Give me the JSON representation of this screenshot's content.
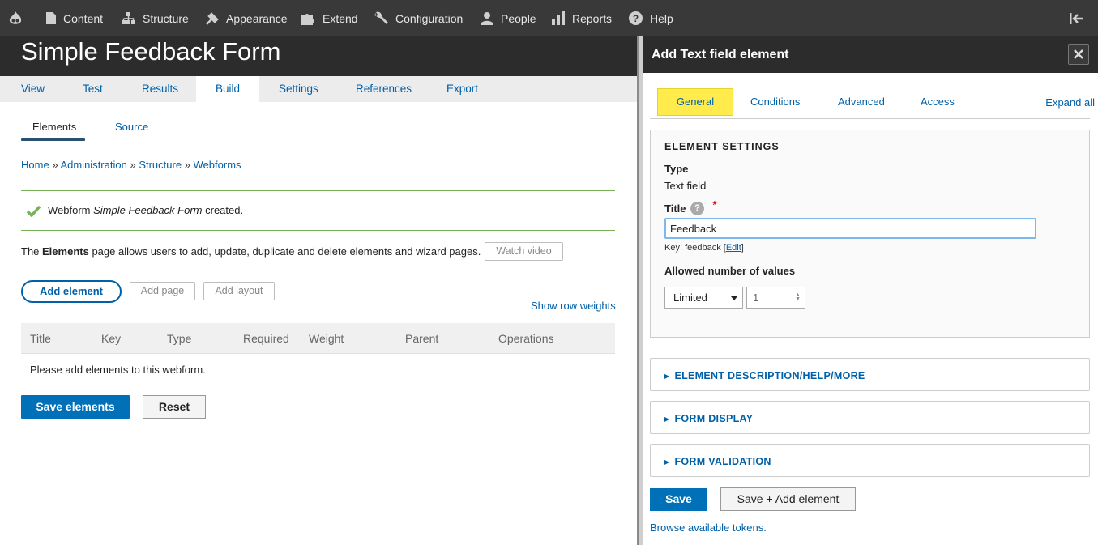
{
  "toolbar": {
    "items": [
      "Content",
      "Structure",
      "Appearance",
      "Extend",
      "Configuration",
      "People",
      "Reports",
      "Help"
    ]
  },
  "header": {
    "title": "Simple Feedback Form"
  },
  "primary_tabs": [
    "View",
    "Test",
    "Results",
    "Build",
    "Settings",
    "References",
    "Export"
  ],
  "active_primary_tab": "Build",
  "secondary_tabs": [
    "Elements",
    "Source"
  ],
  "breadcrumb": [
    "Home",
    "Administration",
    "Structure",
    "Webforms"
  ],
  "breadcrumb_separator": "»",
  "message": {
    "prefix": "Webform ",
    "name": "Simple Feedback Form",
    "suffix": " created."
  },
  "intro": {
    "prefix": "The ",
    "bold": "Elements",
    "suffix": " page allows users to add, update, duplicate and delete elements and wizard pages."
  },
  "buttons": {
    "watch_video": "Watch video",
    "add_element": "Add element",
    "add_page": "Add page",
    "add_layout": "Add layout",
    "show_row_weights": "Show row weights",
    "save_elements": "Save elements",
    "reset": "Reset"
  },
  "table": {
    "columns": [
      "Title",
      "Key",
      "Type",
      "Required",
      "Weight",
      "Parent",
      "Operations"
    ],
    "empty_text": "Please add elements to this webform."
  },
  "dialog": {
    "title": "Add Text field element",
    "tabs": [
      "General",
      "Conditions",
      "Advanced",
      "Access"
    ],
    "expand_all": "Expand all",
    "fieldset_legend": "ELEMENT SETTINGS",
    "type_label": "Type",
    "type_value": "Text field",
    "title_label": "Title",
    "title_help": "?",
    "required_mark": "*",
    "title_value": "Feedback",
    "key_prefix": "Key: feedback [",
    "key_edit": "Edit",
    "key_suffix": "]",
    "allowed_values_label": "Allowed number of values",
    "allowed_select": "Limited",
    "allowed_number": "1",
    "sections": [
      "ELEMENT DESCRIPTION/HELP/MORE",
      "FORM DISPLAY",
      "FORM VALIDATION"
    ],
    "save": "Save",
    "save_add": "Save + Add element",
    "tokens_link": "Browse available tokens."
  },
  "colors": {
    "accent": "#0071b8",
    "link": "#0060a8",
    "active_tab": "#ffec4c",
    "success": "#77b259",
    "toolbar": "#393939"
  }
}
